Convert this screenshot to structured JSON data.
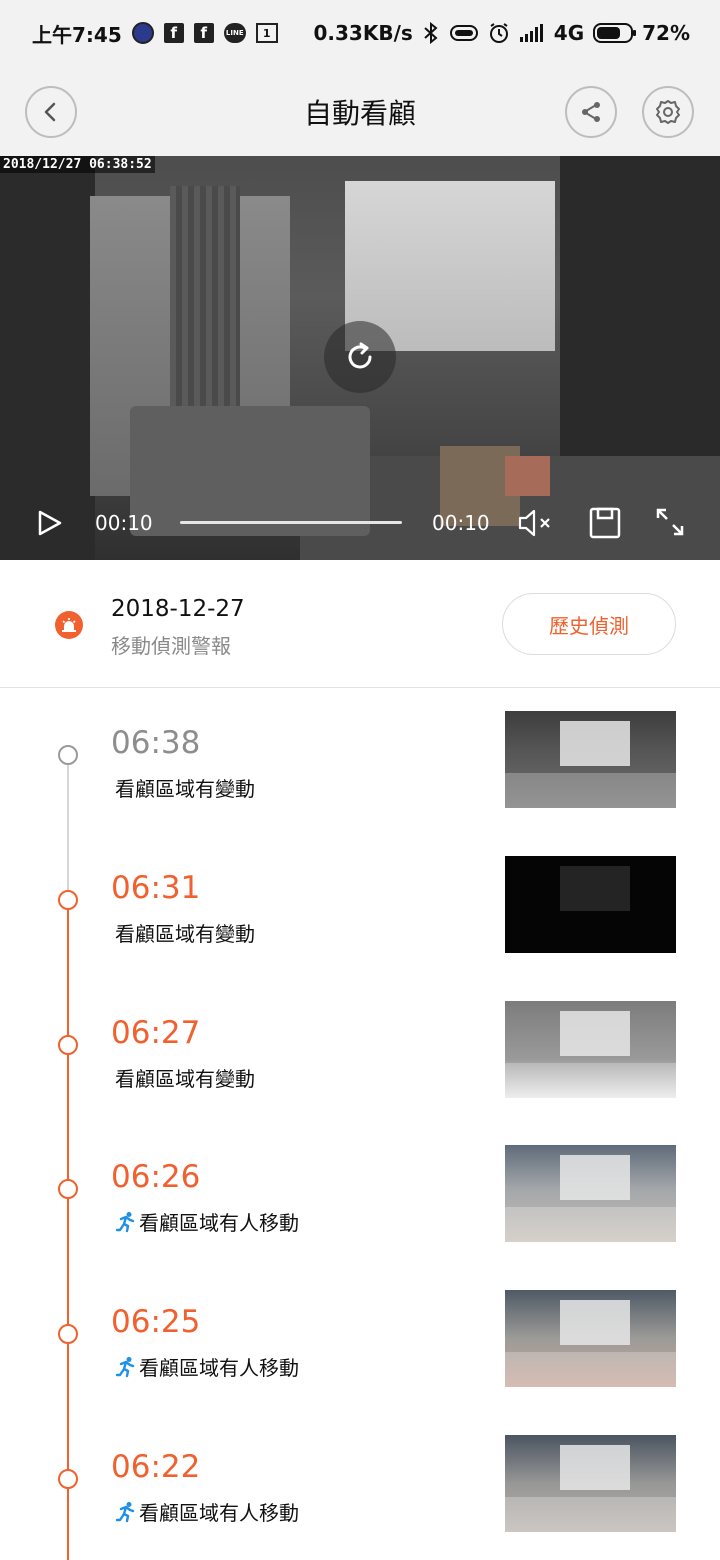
{
  "status_bar": {
    "time": "上午7:45",
    "notif_fb1": "f",
    "notif_fb2": "f",
    "notif_line": "LINE",
    "notif_cal": "1",
    "net_speed": "0.33KB/s",
    "network": "4G",
    "battery_text": "72%",
    "battery_level": 0.72
  },
  "header": {
    "title": "自動看顧"
  },
  "video": {
    "timestamp": "2018/12/27  06:38:52",
    "current_time": "00:10",
    "total_time": "00:10"
  },
  "alarm": {
    "date": "2018-12-27",
    "subtitle": "移動偵測警報",
    "history_button": "歷史偵測"
  },
  "events": [
    {
      "time": "06:38",
      "desc": "看顧區域有變動",
      "type": "change",
      "state": "viewed"
    },
    {
      "time": "06:31",
      "desc": "看顧區域有變動",
      "type": "change",
      "state": "new"
    },
    {
      "time": "06:27",
      "desc": "看顧區域有變動",
      "type": "change",
      "state": "new"
    },
    {
      "time": "06:26",
      "desc": "看顧區域有人移動",
      "type": "person",
      "state": "new"
    },
    {
      "time": "06:25",
      "desc": "看顧區域有人移動",
      "type": "person",
      "state": "new"
    },
    {
      "time": "06:22",
      "desc": "看顧區域有人移動",
      "type": "person",
      "state": "new"
    }
  ],
  "colors": {
    "accent": "#f0612f",
    "person_icon": "#1e90e6",
    "viewed": "#8d8d8d"
  }
}
